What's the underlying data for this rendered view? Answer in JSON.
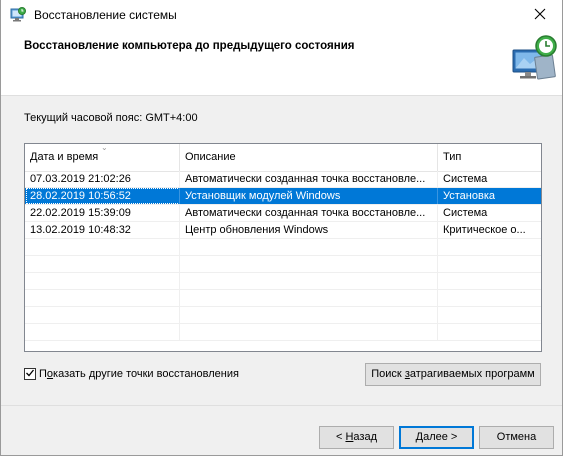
{
  "window": {
    "title": "Восстановление системы",
    "close_glyph": "✕"
  },
  "header": {
    "title": "Восстановление компьютера до предыдущего состояния",
    "illustration_icon": "system-restore-monitor-icon"
  },
  "timezone_label": "Текущий часовой пояс: GMT+4:00",
  "table": {
    "columns": [
      "Дата и время",
      "Описание",
      "Тип"
    ],
    "rows": [
      {
        "date": "07.03.2019 21:02:26",
        "desc": "Автоматически созданная точка восстановле...",
        "type": "Система"
      },
      {
        "date": "28.02.2019 10:56:52",
        "desc": "Установщик модулей Windows",
        "type": "Установка"
      },
      {
        "date": "22.02.2019 15:39:09",
        "desc": "Автоматически созданная точка восстановле...",
        "type": "Система"
      },
      {
        "date": "13.02.2019 10:48:32",
        "desc": "Центр обновления Windows",
        "type": "Критическое о..."
      }
    ],
    "selected_row": 1
  },
  "show_more_checkbox": {
    "checked": true,
    "label_prefix": "П",
    "label_underlined": "о",
    "label_rest": "казать другие точки восстановления"
  },
  "scan_button": {
    "label_prefix": "Поиск ",
    "label_underlined": "з",
    "label_rest": "атрагиваемых программ"
  },
  "footer": {
    "back_prefix": "< ",
    "back_underlined": "Н",
    "back_rest": "азад",
    "next_underlined": "Д",
    "next_rest": "алее >",
    "cancel_label": "Отмена"
  },
  "colors": {
    "selection": "#0078d7",
    "window_bg": "#f0f0f0",
    "header_bg": "#ffffff"
  }
}
